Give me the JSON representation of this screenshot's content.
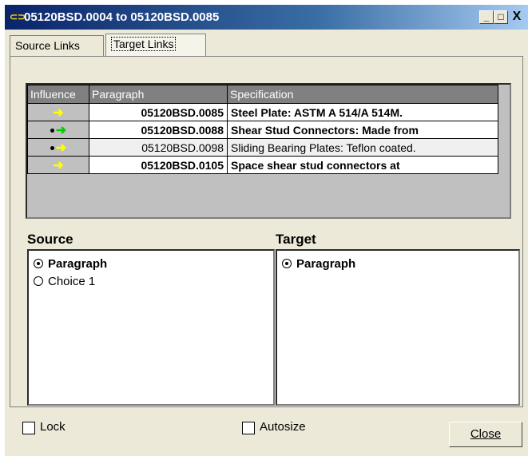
{
  "window": {
    "title": "05120BSD.0004 to 05120BSD.0085",
    "controls": {
      "minimize": "_",
      "maximize": "□",
      "close": "X"
    }
  },
  "tabs": [
    {
      "label": "Source Links",
      "active": false
    },
    {
      "label": "Target Links",
      "active": true
    }
  ],
  "links_table": {
    "headers": [
      "Influence",
      "Paragraph",
      "Specification"
    ],
    "rows": [
      {
        "influence": "arrow-yellow",
        "dot": false,
        "paragraph": "05120BSD.0085",
        "specification": "Steel Plate:  ASTM A 514/A 514M.",
        "bold": true
      },
      {
        "influence": "arrow-green",
        "dot": true,
        "paragraph": "05120BSD.0088",
        "specification": "Shear Stud Connectors:  Made from",
        "bold": true
      },
      {
        "influence": "arrow-yellow",
        "dot": true,
        "paragraph": "05120BSD.0098",
        "specification": "Sliding Bearing Plates:  Teflon coated.",
        "bold": false
      },
      {
        "influence": "arrow-yellow",
        "dot": false,
        "paragraph": "05120BSD.0105",
        "specification": "Space shear stud connectors at",
        "bold": true
      }
    ]
  },
  "source": {
    "label": "Source",
    "options": [
      {
        "label": "Paragraph",
        "selected": true
      },
      {
        "label": "Choice 1",
        "selected": false
      }
    ]
  },
  "target": {
    "label": "Target",
    "options": [
      {
        "label": "Paragraph",
        "selected": true
      }
    ]
  },
  "footer": {
    "lock_label": "Lock",
    "autosize_label": "Autosize",
    "close_label": "Close"
  },
  "colors": {
    "arrow_yellow": "#ffff00",
    "arrow_green": "#00cc00"
  }
}
